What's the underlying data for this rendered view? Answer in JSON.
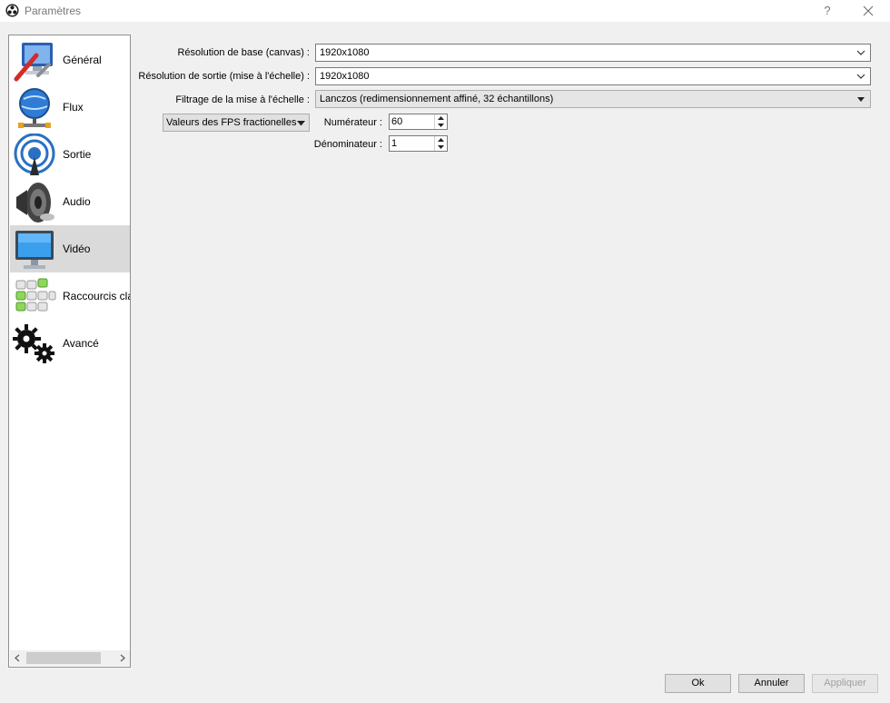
{
  "window": {
    "title": "Paramètres",
    "help_label": "?"
  },
  "sidebar": {
    "items": [
      {
        "label": "Général",
        "icon": "general-icon"
      },
      {
        "label": "Flux",
        "icon": "stream-icon"
      },
      {
        "label": "Sortie",
        "icon": "output-icon"
      },
      {
        "label": "Audio",
        "icon": "speaker-icon"
      },
      {
        "label": "Vidéo",
        "icon": "monitor-icon",
        "selected": true
      },
      {
        "label": "Raccourcis cla",
        "icon": "keyboard-icon"
      },
      {
        "label": "Avancé",
        "icon": "gears-icon"
      }
    ]
  },
  "video": {
    "base_resolution": {
      "label": "Résolution de base (canvas) :",
      "value": "1920x1080"
    },
    "output_resolution": {
      "label": "Résolution de sortie (mise à l'échelle) :",
      "value": "1920x1080"
    },
    "downscale_filter": {
      "label": "Filtrage de la mise à l'échelle :",
      "value": "Lanczos (redimensionnement affiné, 32 échantillons)"
    },
    "fps_type": {
      "value": "Valeurs des FPS fractionelles"
    },
    "numerator": {
      "label": "Numérateur :",
      "value": "60"
    },
    "denominator": {
      "label": "Dénominateur :",
      "value": "1"
    }
  },
  "buttons": {
    "ok": "Ok",
    "cancel": "Annuler",
    "apply": "Appliquer"
  },
  "colors": {
    "selected_bg": "#dadada",
    "window_bg": "#f0f0f0"
  }
}
